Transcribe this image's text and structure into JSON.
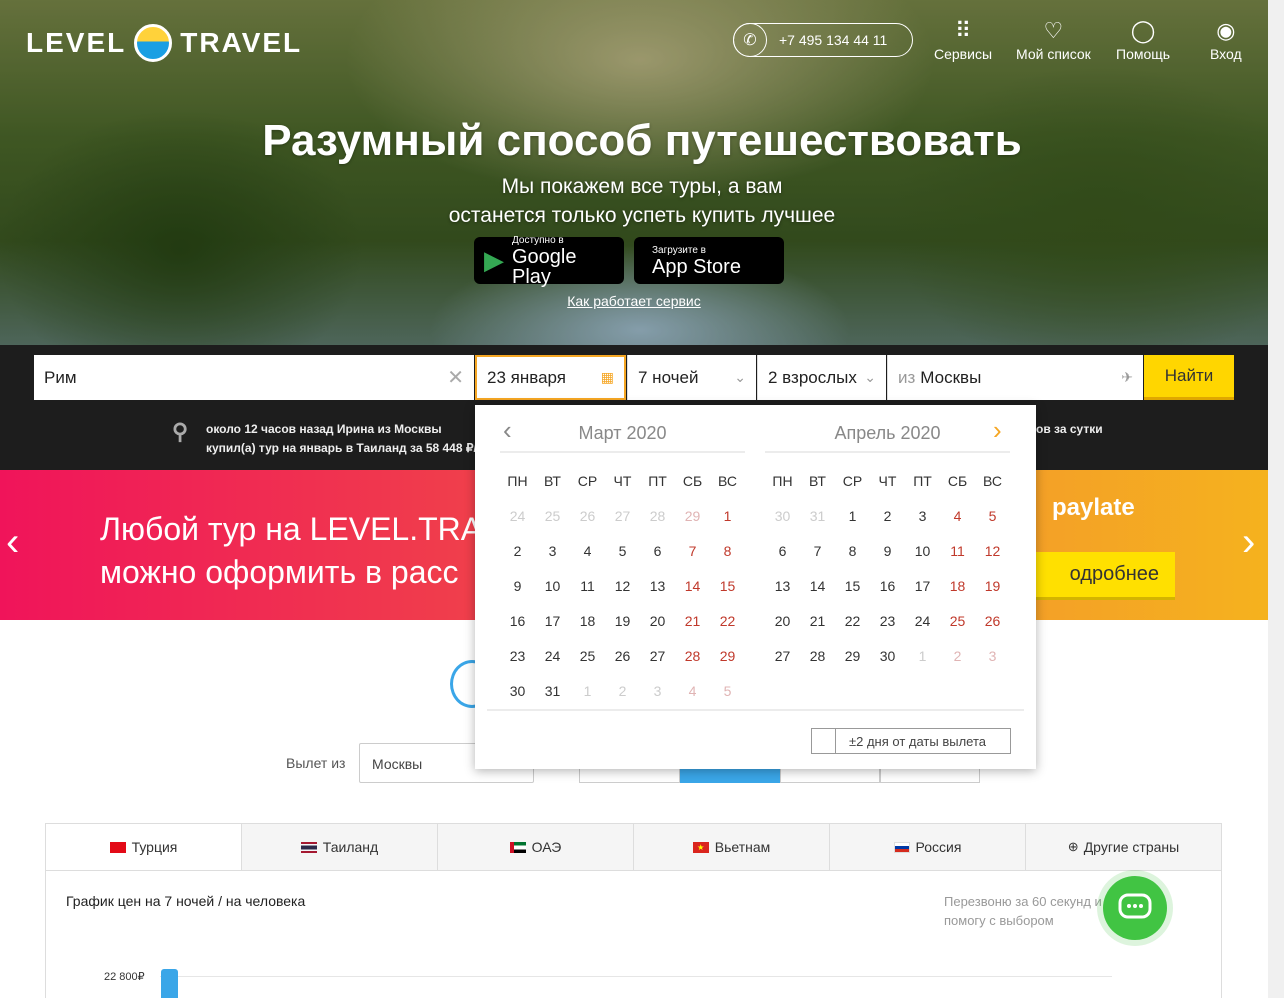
{
  "header": {
    "logo_left": "LEVEL",
    "logo_right": "TRAVEL",
    "phone": "+7 495 134 44 11",
    "nav": [
      {
        "label": "Сервисы",
        "icon": "grid-icon"
      },
      {
        "label": "Мой список",
        "icon": "heart-icon"
      },
      {
        "label": "Помощь",
        "icon": "lightbulb-icon"
      },
      {
        "label": "Вход",
        "icon": "user-icon"
      }
    ]
  },
  "hero": {
    "title": "Разумный способ путешествовать",
    "subtitle_line1": "Мы покажем все туры, а вам",
    "subtitle_line2": "останется только успеть купить лучшее",
    "google_small": "Доступно в",
    "google_big": "Google Play",
    "apple_small": "Загрузите в",
    "apple_big": "App Store",
    "how_link": "Как работает сервис"
  },
  "search": {
    "destination": "Рим",
    "date": "23 января",
    "nights": "7 ночей",
    "guests": "2 взрослых",
    "from_prefix": "из",
    "from_city": "Москвы",
    "find_button": "Найти"
  },
  "notices": {
    "left_line1": "около 12 часов назад Ирина из Москвы",
    "left_line2": "купил(а) тур на январь в Таиланд за 58 448 ₽/",
    "right_line1": "ов за сутки"
  },
  "promo": {
    "line1": "Любой тур на LEVEL.TRA",
    "line2": "можно оформить в расс",
    "brand": "paylate",
    "button": "одробнее"
  },
  "calendar": {
    "weekdays": [
      "ПН",
      "ВТ",
      "СР",
      "ЧТ",
      "ПТ",
      "СБ",
      "ВС"
    ],
    "months": [
      {
        "title": "Март 2020",
        "days": [
          "24",
          "25",
          "26",
          "27",
          "28",
          "29",
          "1",
          "2",
          "3",
          "4",
          "5",
          "6",
          "7",
          "8",
          "9",
          "10",
          "11",
          "12",
          "13",
          "14",
          "15",
          "16",
          "17",
          "18",
          "19",
          "20",
          "21",
          "22",
          "23",
          "24",
          "25",
          "26",
          "27",
          "28",
          "29",
          "30",
          "31",
          "1",
          "2",
          "3",
          "4",
          "5"
        ],
        "out_before": 6,
        "out_after": 5
      },
      {
        "title": "Апрель 2020",
        "days": [
          "30",
          "31",
          "1",
          "2",
          "3",
          "4",
          "5",
          "6",
          "7",
          "8",
          "9",
          "10",
          "11",
          "12",
          "13",
          "14",
          "15",
          "16",
          "17",
          "18",
          "19",
          "20",
          "21",
          "22",
          "23",
          "24",
          "25",
          "26",
          "27",
          "28",
          "29",
          "30",
          "1",
          "2",
          "3"
        ],
        "out_before": 2,
        "out_after": 3
      }
    ],
    "flex_label": "±2 дня от даты вылета"
  },
  "filters": {
    "depart_label": "Вылет из",
    "depart_value": "Москвы"
  },
  "tabs": [
    {
      "label": "Турция",
      "flag": "turkey-flag-icon"
    },
    {
      "label": "Таиланд",
      "flag": "thailand-flag-icon"
    },
    {
      "label": "ОАЭ",
      "flag": "uae-flag-icon"
    },
    {
      "label": "Вьетнам",
      "flag": "vietnam-flag-icon"
    },
    {
      "label": "Россия",
      "flag": "russia-flag-icon"
    },
    {
      "label": "Другие страны",
      "flag": "globe-icon"
    }
  ],
  "graph": {
    "title": "График цен на 7 ночей / на человека",
    "price_label": "22 800₽",
    "callback_line1": "Перезвоню за 60 секунд и",
    "callback_line2": "помогу с выбором"
  }
}
